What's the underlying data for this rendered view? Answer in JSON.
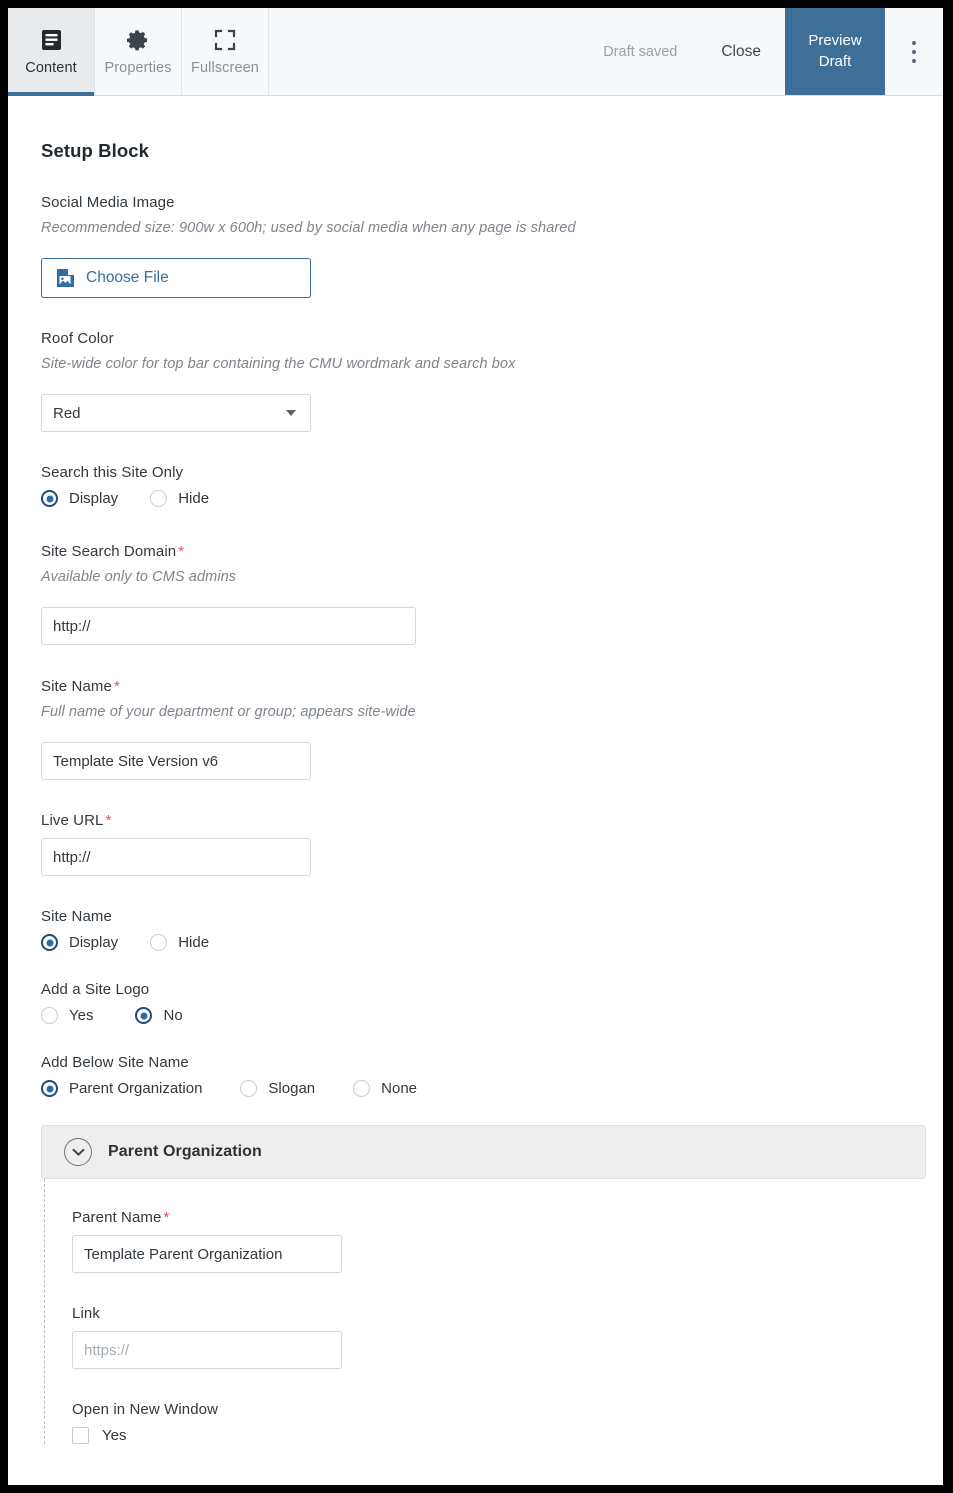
{
  "toolbar": {
    "tabs": [
      {
        "label": "Content",
        "icon": "document-list-icon",
        "active": true
      },
      {
        "label": "Properties",
        "icon": "gear-icon",
        "active": false
      },
      {
        "label": "Fullscreen",
        "icon": "fullscreen-icon",
        "active": false
      }
    ],
    "draft_status": "Draft saved",
    "close_label": "Close",
    "preview_label_line1": "Preview",
    "preview_label_line2": "Draft",
    "more_menu_icon": "kebab-menu-icon",
    "accent_color": "#3d6f99"
  },
  "page": {
    "title": "Setup Block"
  },
  "fields": {
    "social_media_image": {
      "label": "Social Media Image",
      "help": "Recommended size: 900w x 600h; used by social media when any page is shared",
      "button_label": "Choose File",
      "button_icon": "image-file-icon"
    },
    "roof_color": {
      "label": "Roof Color",
      "help": "Site-wide color for top bar containing the CMU wordmark and search box",
      "value": "Red",
      "caret_icon": "chevron-down-icon"
    },
    "search_this_site_only": {
      "label": "Search this Site Only",
      "options": [
        {
          "label": "Display",
          "checked": true
        },
        {
          "label": "Hide",
          "checked": false
        }
      ]
    },
    "site_search_domain": {
      "label": "Site Search Domain",
      "required": "*",
      "help": "Available only to CMS admins",
      "value": "http://"
    },
    "site_name_text": {
      "label": "Site Name",
      "required": "*",
      "help": "Full name of your department or group; appears site-wide",
      "value": "Template Site Version v6"
    },
    "live_url": {
      "label": "Live URL",
      "required": "*",
      "value": "http://"
    },
    "site_name_visibility": {
      "label": "Site Name",
      "options": [
        {
          "label": "Display",
          "checked": true
        },
        {
          "label": "Hide",
          "checked": false
        }
      ]
    },
    "add_site_logo": {
      "label": "Add a Site Logo",
      "options": [
        {
          "label": "Yes",
          "checked": false
        },
        {
          "label": "No",
          "checked": true
        }
      ]
    },
    "add_below_site_name": {
      "label": "Add Below Site Name",
      "options": [
        {
          "label": "Parent Organization",
          "checked": true
        },
        {
          "label": "Slogan",
          "checked": false
        },
        {
          "label": "None",
          "checked": false
        }
      ]
    }
  },
  "parent_organization_panel": {
    "title": "Parent Organization",
    "chevron_icon": "chevron-down-circle-icon",
    "parent_name": {
      "label": "Parent Name",
      "required": "*",
      "value": "Template Parent Organization"
    },
    "link": {
      "label": "Link",
      "placeholder": "https://"
    },
    "open_in_new_window": {
      "label": "Open in New Window",
      "checkbox_label": "Yes",
      "checked": false
    }
  }
}
